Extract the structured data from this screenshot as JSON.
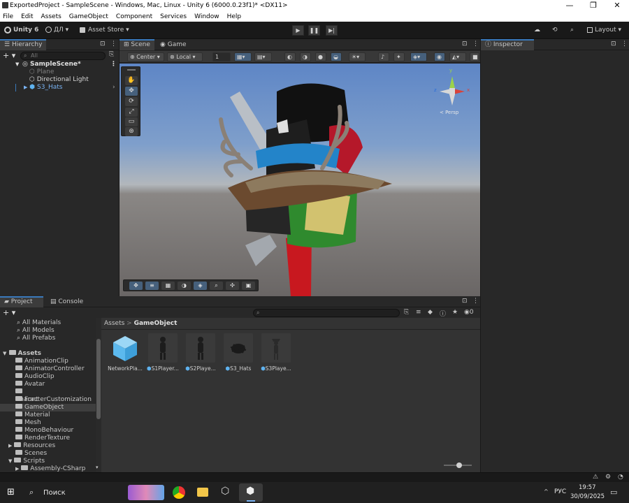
{
  "window": {
    "title": "ExportedProject - SampleScene - Windows, Mac, Linux - Unity 6 (6000.0.23f1)* <DX11>",
    "controls": [
      "—",
      "❐",
      "✕"
    ]
  },
  "menu": [
    "File",
    "Edit",
    "Assets",
    "GameObject",
    "Component",
    "Services",
    "Window",
    "Help"
  ],
  "toolbar": {
    "unity_version": "Unity 6",
    "account": "ДЛ",
    "asset_store": "Asset Store",
    "layout": "Layout"
  },
  "hierarchy": {
    "tab": "Hierarchy",
    "search_placeholder": "All",
    "items": [
      {
        "label": "SampleScene*",
        "depth": 0
      },
      {
        "label": "Plane",
        "depth": 1
      },
      {
        "label": "Directional Light",
        "depth": 1
      },
      {
        "label": "S3_Hats",
        "depth": 1
      }
    ]
  },
  "scene": {
    "tabs": [
      "Scene",
      "Game"
    ],
    "pivot": "Center",
    "space": "Local",
    "grid_value": "1",
    "gizmo_label": "< Persp",
    "gizmo_axes": [
      "y",
      "x",
      "z"
    ]
  },
  "inspector": {
    "tab": "Inspector"
  },
  "project": {
    "tabs": [
      "Project",
      "Console"
    ],
    "breadcrumb": [
      "Assets",
      "GameObject"
    ],
    "hidden_count": "0",
    "tree": [
      {
        "label": "All Materials",
        "indent": 1,
        "folder": false
      },
      {
        "label": "All Models",
        "indent": 1,
        "folder": false
      },
      {
        "label": "All Prefabs",
        "indent": 1,
        "folder": false
      },
      {
        "label": "Assets",
        "indent": 0,
        "folder": true,
        "bold": true
      },
      {
        "label": "AnimationClip",
        "indent": 1,
        "folder": true
      },
      {
        "label": "AnimatorController",
        "indent": 1,
        "folder": true
      },
      {
        "label": "AudioClip",
        "indent": 1,
        "folder": true
      },
      {
        "label": "Avatar",
        "indent": 1,
        "folder": true
      },
      {
        "label": "CharacterCustomization",
        "indent": 1,
        "folder": true
      },
      {
        "label": "Font",
        "indent": 1,
        "folder": true
      },
      {
        "label": "GameObject",
        "indent": 1,
        "folder": true,
        "selected": true
      },
      {
        "label": "Material",
        "indent": 1,
        "folder": true
      },
      {
        "label": "Mesh",
        "indent": 1,
        "folder": true
      },
      {
        "label": "MonoBehaviour",
        "indent": 1,
        "folder": true
      },
      {
        "label": "RenderTexture",
        "indent": 1,
        "folder": true
      },
      {
        "label": "Resources",
        "indent": 1,
        "folder": true
      },
      {
        "label": "Scenes",
        "indent": 1,
        "folder": true
      },
      {
        "label": "Scripts",
        "indent": 1,
        "folder": true
      },
      {
        "label": "Assembly-CSharp",
        "indent": 2,
        "folder": true
      }
    ],
    "assets": [
      "NetworkPla...",
      "S1Player...",
      "S2Playe...",
      "S3_Hats",
      "S3Playe..."
    ]
  },
  "taskbar": {
    "search": "Поиск",
    "lang": "РУС",
    "time": "19:57",
    "date": "30/09/2025"
  },
  "colors": {
    "accent": "#3a79bb",
    "selected_text": "#7ab4f5",
    "panel": "#282828"
  }
}
